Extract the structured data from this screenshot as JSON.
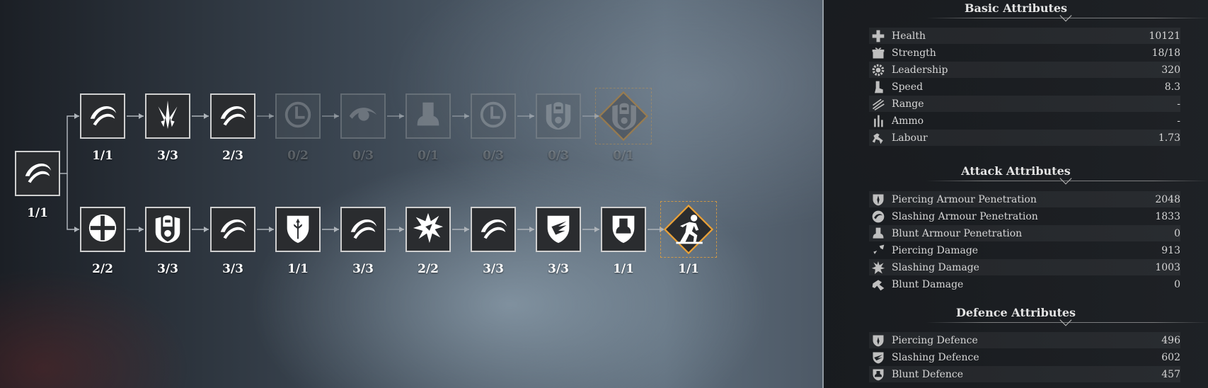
{
  "skill_tree": {
    "root": {
      "icon": "crescent-slash-icon",
      "rank": "1/1"
    },
    "top_row": [
      {
        "icon": "crescent-slash-icon",
        "rank": "1/1",
        "locked": false
      },
      {
        "icon": "spear-burst-icon",
        "rank": "3/3",
        "locked": false
      },
      {
        "icon": "crescent-slash-icon",
        "rank": "2/3",
        "locked": false
      },
      {
        "icon": "clock-icon",
        "rank": "0/2",
        "locked": true
      },
      {
        "icon": "eye-swirl-icon",
        "rank": "0/3",
        "locked": true
      },
      {
        "icon": "bell-weight-icon",
        "rank": "0/1",
        "locked": true
      },
      {
        "icon": "clock-icon",
        "rank": "0/3",
        "locked": true
      },
      {
        "icon": "knight-crest-icon",
        "rank": "0/3",
        "locked": true
      },
      {
        "icon": "knight-crest-icon",
        "rank": "0/1",
        "locked": true,
        "final": true
      }
    ],
    "bottom_row": [
      {
        "icon": "cross-shield-icon",
        "rank": "2/2",
        "locked": false
      },
      {
        "icon": "knight-crest-icon",
        "rank": "3/3",
        "locked": false
      },
      {
        "icon": "crescent-slash-icon",
        "rank": "3/3",
        "locked": false
      },
      {
        "icon": "arrow-shield-icon",
        "rank": "1/1",
        "locked": false
      },
      {
        "icon": "crescent-slash-icon",
        "rank": "3/3",
        "locked": false
      },
      {
        "icon": "impact-burst-icon",
        "rank": "2/2",
        "locked": false
      },
      {
        "icon": "crescent-slash-icon",
        "rank": "3/3",
        "locked": false
      },
      {
        "icon": "wing-shield-icon",
        "rank": "3/3",
        "locked": false
      },
      {
        "icon": "bell-shield-icon",
        "rank": "1/1",
        "locked": false
      },
      {
        "icon": "running-man-icon",
        "rank": "1/1",
        "locked": false,
        "final": true
      }
    ]
  },
  "attributes": {
    "basic": {
      "title": "Basic Attributes",
      "rows": [
        {
          "icon": "health-cross-icon",
          "name": "Health",
          "value": "10121"
        },
        {
          "icon": "strength-gift-icon",
          "name": "Strength",
          "value": "18/18"
        },
        {
          "icon": "leadership-gear-icon",
          "name": "Leadership",
          "value": "320"
        },
        {
          "icon": "speed-boot-icon",
          "name": "Speed",
          "value": "8.3"
        },
        {
          "icon": "range-arrows-icon",
          "name": "Range",
          "value": "-"
        },
        {
          "icon": "ammo-bars-icon",
          "name": "Ammo",
          "value": "-"
        },
        {
          "icon": "labour-horse-icon",
          "name": "Labour",
          "value": "1.73"
        }
      ]
    },
    "attack": {
      "title": "Attack Attributes",
      "rows": [
        {
          "icon": "piercing-penetration-icon",
          "name": "Piercing Armour Penetration",
          "value": "2048"
        },
        {
          "icon": "slashing-penetration-icon",
          "name": "Slashing Armour Penetration",
          "value": "1833"
        },
        {
          "icon": "blunt-penetration-icon",
          "name": "Blunt Armour Penetration",
          "value": "0"
        },
        {
          "icon": "piercing-damage-icon",
          "name": "Piercing Damage",
          "value": "913"
        },
        {
          "icon": "slashing-damage-icon",
          "name": "Slashing Damage",
          "value": "1003"
        },
        {
          "icon": "blunt-damage-icon",
          "name": "Blunt Damage",
          "value": "0"
        }
      ]
    },
    "defence": {
      "title": "Defence Attributes",
      "rows": [
        {
          "icon": "piercing-defence-icon",
          "name": "Piercing Defence",
          "value": "496"
        },
        {
          "icon": "slashing-defence-icon",
          "name": "Slashing Defence",
          "value": "602"
        },
        {
          "icon": "blunt-defence-icon",
          "name": "Blunt Defence",
          "value": "457"
        }
      ]
    }
  },
  "colors": {
    "accent": "#e8a13a",
    "node_border": "#cfcfcf",
    "node_fill": "#2a2c2f"
  }
}
